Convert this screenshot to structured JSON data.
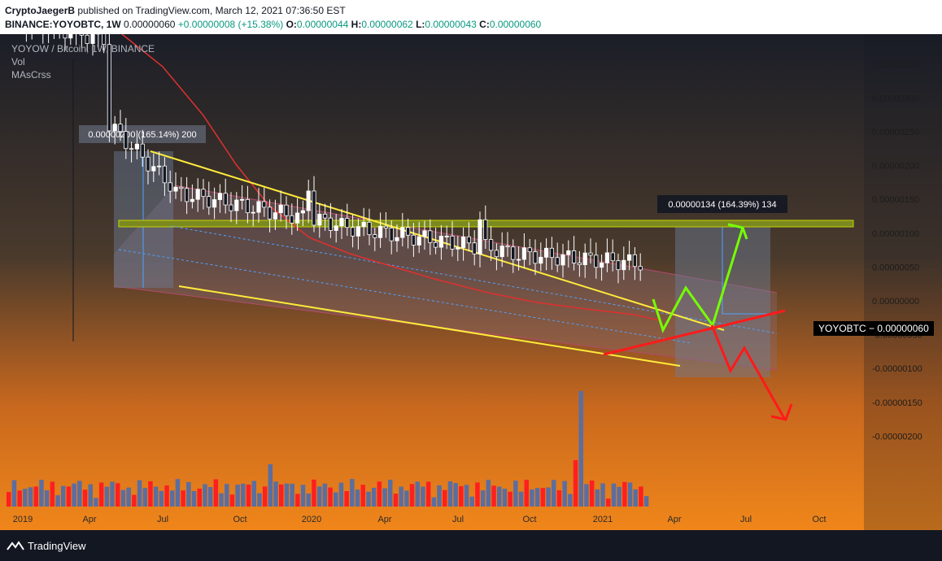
{
  "header": {
    "author": "CryptoJaegerB",
    "published": "published on TradingView.com, March 12, 2021 07:36:50 EST",
    "symbol": "BINANCE:YOYOBTC, 1W",
    "last": "0.00000060",
    "change": "+0.00000008 (+15.38%)",
    "o_label": "O:",
    "o": "0.00000044",
    "h_label": "H:",
    "h": "0.00000062",
    "l_label": "L:",
    "l": "0.00000043",
    "c_label": "C:",
    "c": "0.00000060"
  },
  "legend": {
    "title": "YOYOW / Bitcoin, 1W, BINANCE",
    "vol": "Vol",
    "ma": "MAsCrss"
  },
  "price_axis": {
    "labels": [
      "0.00000450",
      "0.00000400",
      "0.00000350",
      "0.00000300",
      "0.00000250",
      "0.00000200",
      "0.00000150",
      "0.00000100",
      "0.00000050",
      "0.00000000",
      "-0.00000050",
      "-0.00000100",
      "-0.00000150",
      "-0.00000200"
    ],
    "values": [
      450,
      400,
      350,
      300,
      250,
      200,
      150,
      100,
      50,
      0,
      -50,
      -100,
      -150,
      -200
    ]
  },
  "time_axis": [
    "2019",
    "Apr",
    "Jul",
    "Oct",
    "2020",
    "Apr",
    "Jul",
    "Oct",
    "2021",
    "Apr",
    "Jul",
    "Oct"
  ],
  "price_tag": "YOYOBTC − 0.00000060",
  "measure_left": "0.00000200 (165.14%) 200",
  "measure_right": "0.00000134 (164.39%) 134",
  "footer": {
    "brand": "TradingView"
  },
  "chart_data": {
    "type": "candlestick",
    "unit_note": "prices in units of 0.00000001 BTC",
    "ylim": [
      -210,
      470
    ],
    "bullish_color": "#ffffff",
    "bearish_color": "#131722",
    "ma_color": "#e0302f",
    "resistance_color": "#ffeb3b",
    "support_zone_color": "#7a8a1f",
    "bull_path_color": "#76ff03",
    "bear_path_color": "#ff1a1a",
    "volume_up_color": "#5b6ea0",
    "volume_down_color": "#ff1f1f"
  }
}
